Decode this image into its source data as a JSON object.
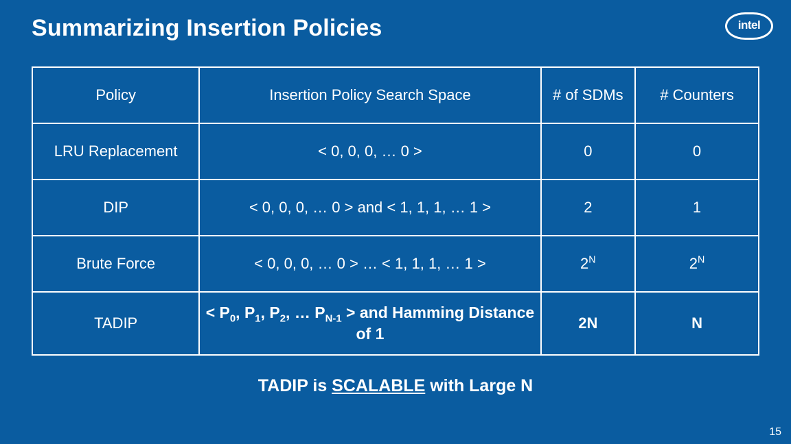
{
  "title": "Summarizing Insertion Policies",
  "logo_text": "intel",
  "headers": {
    "policy": "Policy",
    "space": "Insertion Policy Search Space",
    "sdms": "# of SDMs",
    "counters": "# Counters"
  },
  "rows": {
    "lru": {
      "policy": "LRU Replacement",
      "space": "< 0, 0, 0, … 0 >",
      "sdms": "0",
      "counters": "0"
    },
    "dip": {
      "policy": "DIP",
      "space": "< 0, 0, 0, … 0 > and < 1, 1, 1, … 1 >",
      "sdms": "2",
      "counters": "1"
    },
    "brute": {
      "policy": "Brute Force",
      "space": "< 0, 0, 0, … 0 > … < 1, 1, 1, … 1 >",
      "sdms_base": "2",
      "sdms_exp": "N",
      "cnt_base": "2",
      "cnt_exp": "N"
    },
    "tadip": {
      "policy": "TADIP",
      "space_pre": "< P",
      "s0": "0",
      "s1": "1",
      "s2": "2",
      "mid1": ", P",
      "mid2": ", P",
      "mid3": ", … P",
      "sN": "N-1",
      "space_post": " > and Hamming Distance of 1",
      "sdms": "2N",
      "counters": "N"
    }
  },
  "caption": {
    "pre": "TADIP is ",
    "scalable": "SCALABLE",
    "post": " with Large N"
  },
  "page_number": "15",
  "chart_data": {
    "type": "table",
    "title": "Summarizing Insertion Policies",
    "columns": [
      "Policy",
      "Insertion Policy Search Space",
      "# of SDMs",
      "# Counters"
    ],
    "rows": [
      [
        "LRU Replacement",
        "< 0, 0, 0, … 0 >",
        "0",
        "0"
      ],
      [
        "DIP",
        "< 0, 0, 0, … 0 > and < 1, 1, 1, … 1 >",
        "2",
        "1"
      ],
      [
        "Brute Force",
        "< 0, 0, 0, … 0 > … < 1, 1, 1, … 1 >",
        "2^N",
        "2^N"
      ],
      [
        "TADIP",
        "< P0, P1, P2, … P(N-1) > and Hamming Distance of 1",
        "2N",
        "N"
      ]
    ],
    "annotation": "TADIP is SCALABLE with Large N"
  }
}
